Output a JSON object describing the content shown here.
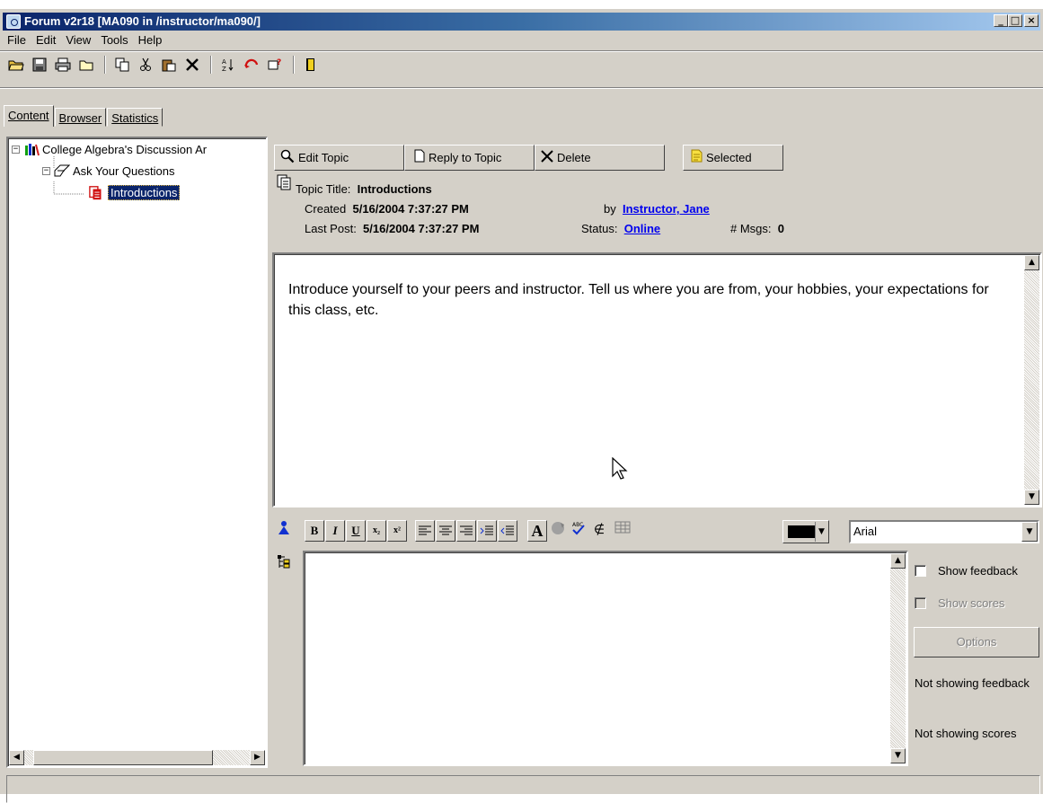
{
  "window": {
    "title": "Forum v2r18  [MA090 in /instructor/ma090/]",
    "controls": {
      "minimize": "_",
      "maximize": "□",
      "close": "×"
    }
  },
  "menu": [
    "File",
    "Edit",
    "View",
    "Tools",
    "Help"
  ],
  "toolbar_icons": [
    "open-folder-icon",
    "save-icon",
    "print-icon",
    "folder-icon",
    "copy-icon",
    "cut-icon",
    "paste-icon",
    "delete-icon",
    "sort-icon",
    "refresh-icon",
    "help-icon",
    "exit-icon"
  ],
  "tabs": [
    {
      "label": "Content",
      "active": true
    },
    {
      "label": "Browser",
      "active": false
    },
    {
      "label": "Statistics",
      "active": false
    }
  ],
  "tree": {
    "root": "College Algebra's Discussion Ar",
    "child": "Ask Your Questions",
    "selected": "Introductions",
    "expander_collapse": "−"
  },
  "topic_buttons": {
    "edit": "Edit Topic",
    "reply": "Reply to Topic",
    "delete": "Delete",
    "selected": "Selected"
  },
  "topic": {
    "title_label": "Topic Title:",
    "title": "Introductions",
    "created_label": "Created",
    "created": "5/16/2004 7:37:27 PM",
    "by_label": "by",
    "author": "Instructor, Jane",
    "last_post_label": "Last Post:",
    "last_post": "5/16/2004 7:37:27 PM",
    "status_label": "Status:",
    "status": "Online",
    "msgs_label": "# Msgs:",
    "msgs": "0"
  },
  "message": {
    "body": "Introduce yourself to your peers and instructor.  Tell us where you are from, your hobbies, your expectations for this class, etc."
  },
  "format_bar": {
    "bold": "B",
    "italic": "I",
    "underline": "U",
    "subscript": "x₂",
    "superscript": "x²",
    "font_color_letter": "A",
    "font": "Arial"
  },
  "feedback": {
    "show_feedback": "Show feedback",
    "show_scores": "Show scores",
    "options": "Options",
    "not_showing_feedback": "Not showing feedback",
    "not_showing_scores": "Not showing scores"
  },
  "colors": {
    "title_start": "#0a246a",
    "title_end": "#a6caf0",
    "face": "#d4d0c8",
    "link": "#0000ee",
    "selection": "#0a246a",
    "red_icon": "#d01010"
  }
}
